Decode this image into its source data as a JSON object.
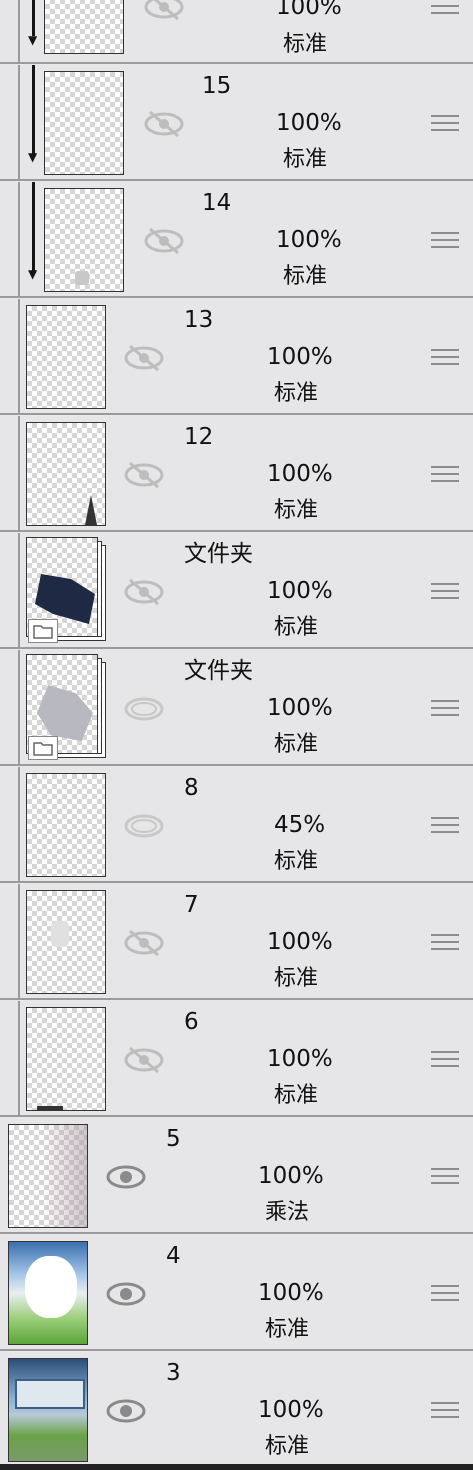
{
  "layers": [
    {
      "name": "",
      "opacity": "100%",
      "blend": "标准",
      "visible": false,
      "clipped": true
    },
    {
      "name": "15",
      "opacity": "100%",
      "blend": "标准",
      "visible": false,
      "clipped": true
    },
    {
      "name": "14",
      "opacity": "100%",
      "blend": "标准",
      "visible": false,
      "clipped": true
    },
    {
      "name": "13",
      "opacity": "100%",
      "blend": "标准",
      "visible": false,
      "clipped": false
    },
    {
      "name": "12",
      "opacity": "100%",
      "blend": "标准",
      "visible": false,
      "clipped": false
    },
    {
      "name": "文件夹",
      "opacity": "100%",
      "blend": "标准",
      "visible": false,
      "folder": true
    },
    {
      "name": "文件夹",
      "opacity": "100%",
      "blend": "标准",
      "visible": false,
      "folder": true
    },
    {
      "name": "8",
      "opacity": "45%",
      "blend": "标准",
      "visible": false
    },
    {
      "name": "7",
      "opacity": "100%",
      "blend": "标准",
      "visible": false
    },
    {
      "name": "6",
      "opacity": "100%",
      "blend": "标准",
      "visible": false
    },
    {
      "name": "5",
      "opacity": "100%",
      "blend": "乘法",
      "visible": true
    },
    {
      "name": "4",
      "opacity": "100%",
      "blend": "标准",
      "visible": true
    },
    {
      "name": "3",
      "opacity": "100%",
      "blend": "标准",
      "visible": true
    }
  ],
  "colors": {
    "background": "#e6e6e8",
    "divider": "#9a9a9a",
    "eye_hidden": "#bdbdbd",
    "eye_visible": "#8a8a8a"
  },
  "icons": {
    "visibility": "eye-icon",
    "visibility_off": "eye-off-icon",
    "folder": "folder-icon",
    "drag": "drag-handle-icon"
  }
}
